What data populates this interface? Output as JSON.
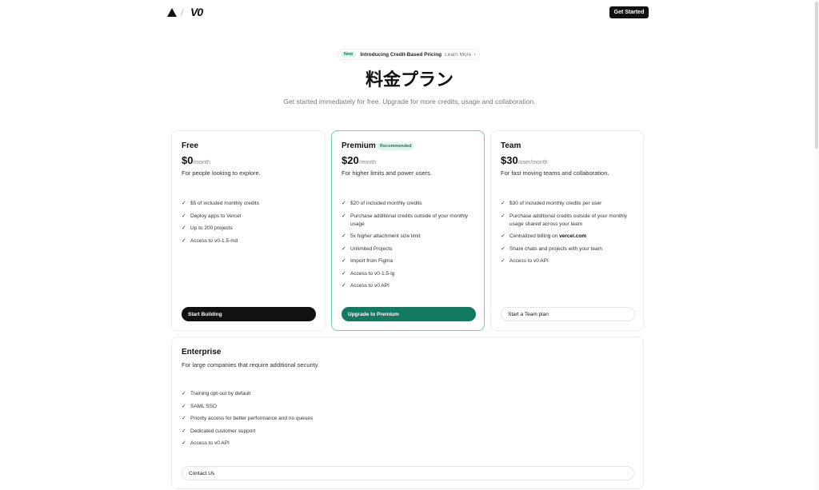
{
  "header": {
    "logo_icon": "triangle-logo-icon",
    "logo_separator": "/",
    "logo_v0": "V0",
    "get_started_label": "Get Started"
  },
  "announcement": {
    "badge": "New",
    "text": "Introducing Credit-Based Pricing",
    "link": "Learn More",
    "chevron": "›"
  },
  "hero": {
    "title": "料金プラン",
    "subtitle": "Get started immediately for free. Upgrade for more credits, usage and collaboration."
  },
  "plans": {
    "free": {
      "name": "Free",
      "price": "$0",
      "period": "/month",
      "description": "For people looking to explore.",
      "features": [
        "$5 of included monthly credits",
        "Deploy apps to Vercel",
        "Up to 200 projects",
        "Access to v0-1.5-md"
      ],
      "cta": "Start Building"
    },
    "premium": {
      "name": "Premium",
      "badge": "Recommended",
      "price": "$20",
      "period": "/month",
      "description": "For higher limits and power users.",
      "features": [
        "$20 of included monthly credits",
        "Purchase additional credits outside of your monthly usage",
        "5x higher attachment size limit",
        "Unlimited Projects",
        "Import from Figma",
        "Access to v0-1.5-lg",
        "Access to v0 API"
      ],
      "cta": "Upgrade to Premium"
    },
    "team": {
      "name": "Team",
      "price": "$30",
      "period": "/user/month",
      "description": "For fast moving teams and collaboration.",
      "features": [
        "$30 of included monthly credits per user",
        "Purchase additional credits outside of your monthly usage shared across your team",
        "Centralized billing on",
        "Share chats and projects with your team",
        "Access to v0 API"
      ],
      "billing_domain": "vercel.com",
      "cta": "Start a Team plan"
    },
    "enterprise": {
      "name": "Enterprise",
      "description": "For large companies that require additional security.",
      "features": [
        "Training opt-out by default",
        "SAML SSO",
        "Priority access for better performance and no queues",
        "Dedicated customer support",
        "Access to v0 API"
      ],
      "cta": "Contact Us"
    }
  },
  "check_glyph": "✓",
  "colors": {
    "accent_green": "#127a62",
    "badge_bg": "#dff5ec",
    "premium_border": "#6fd0ae"
  }
}
